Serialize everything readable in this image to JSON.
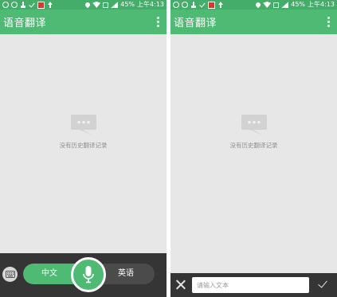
{
  "status_bar": {
    "battery": "45%",
    "time": "上午4:13"
  },
  "app": {
    "title": "语音翻译"
  },
  "empty_state": {
    "message": "没有历史翻译记录"
  },
  "voice_panel": {
    "source_language": "中文",
    "target_language": "英语"
  },
  "text_panel": {
    "input_placeholder": "请输入文本",
    "input_value": ""
  },
  "colors": {
    "brand_green": "#4fba74",
    "status_green": "#43ad69",
    "dark_bar": "#353535"
  },
  "icons": [
    "keyboard-icon",
    "microphone-icon",
    "close-icon",
    "checkmark-icon",
    "overflow-menu-icon",
    "chat-bubble-icon"
  ]
}
